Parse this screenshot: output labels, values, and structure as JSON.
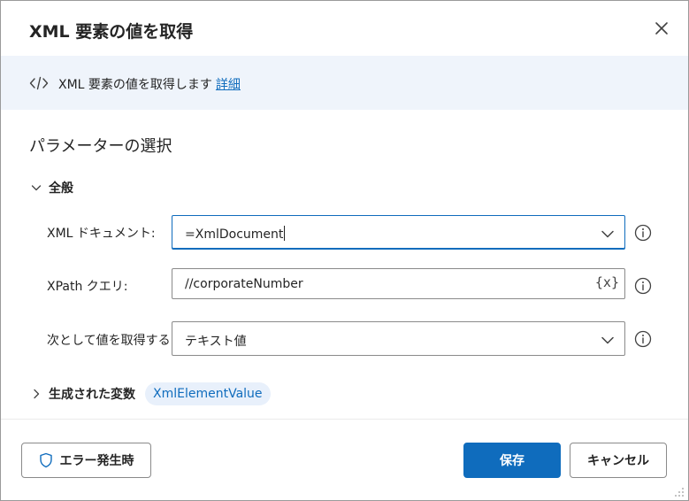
{
  "dialog": {
    "title": "XML 要素の値を取得",
    "close_icon": "close-icon"
  },
  "banner": {
    "icon": "code-icon",
    "text": "XML 要素の値を取得します",
    "link": "詳細"
  },
  "parameters": {
    "section_title": "パラメーターの選択",
    "group_label": "全般",
    "fields": [
      {
        "label": "XML ドキュメント:",
        "value": "=XmlDocument",
        "kind": "dropdown"
      },
      {
        "label": "XPath クエリ:",
        "value": "//corporateNumber",
        "kind": "text",
        "var_button": "{x}"
      },
      {
        "label": "次として値を取得する:",
        "value": "テキスト値",
        "kind": "dropdown"
      }
    ]
  },
  "variables": {
    "label": "生成された変数",
    "chip": "XmlElementValue"
  },
  "footer": {
    "error_button": "エラー発生時",
    "save_button": "保存",
    "cancel_button": "キャンセル"
  },
  "colors": {
    "accent": "#0f6cbd",
    "banner_bg": "#eff4fb",
    "chip_bg": "#e8f0fb"
  }
}
